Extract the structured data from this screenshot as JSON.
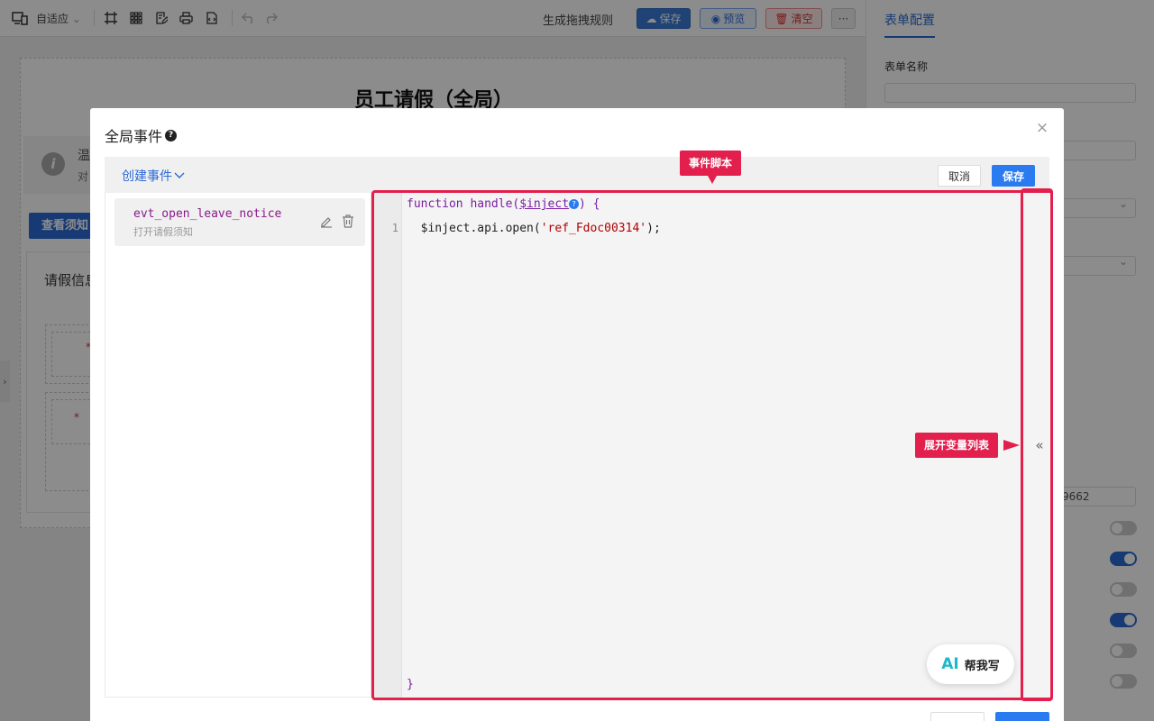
{
  "toolbar": {
    "adapt_label": "自适应",
    "gen_rules": "生成拖拽规则",
    "save": "保存",
    "preview": "预览",
    "clear": "清空",
    "more": "···"
  },
  "right_panel": {
    "tab": "表单配置",
    "form_name_label": "表单名称",
    "partial_value": "9662"
  },
  "form": {
    "title": "员工请假（全局）",
    "tip_title": "温",
    "tip_sub": "对",
    "view_button": "查看须知",
    "section_title": "请假信息"
  },
  "modal": {
    "title": "全局事件",
    "help": "?",
    "close": "×",
    "create_event": "创建事件",
    "cancel": "取消",
    "save": "保存",
    "event": {
      "name": "evt_open_leave_notice",
      "desc": "打开请假须知"
    },
    "code": {
      "fn_head": "function handle(",
      "param": "$inject",
      "param_help": "?",
      "fn_tail": ") {",
      "line_number": "1",
      "body_plain_a": "  $inject.api.open(",
      "body_string": "'ref_Fdoc00314'",
      "body_plain_b": ");",
      "close_brace": "}"
    },
    "expand_icon": "«",
    "ai": {
      "logo": "AI",
      "label": "帮我写"
    }
  },
  "callouts": {
    "script_tag": "事件脚本",
    "vars_tag": "展开变量列表"
  },
  "colors": {
    "accent": "#2b7bf0",
    "callout": "#e21f4d"
  }
}
